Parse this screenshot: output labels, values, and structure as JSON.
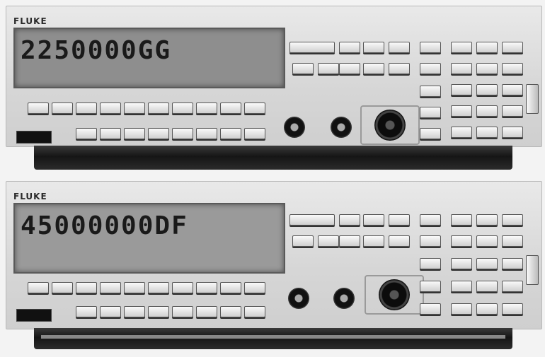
{
  "photo": {
    "subject": "two bench instruments",
    "units": [
      {
        "brand": "FLUKE",
        "readout": "2250000GG"
      },
      {
        "brand": "FLUKE",
        "readout": "45000000DF"
      }
    ]
  }
}
